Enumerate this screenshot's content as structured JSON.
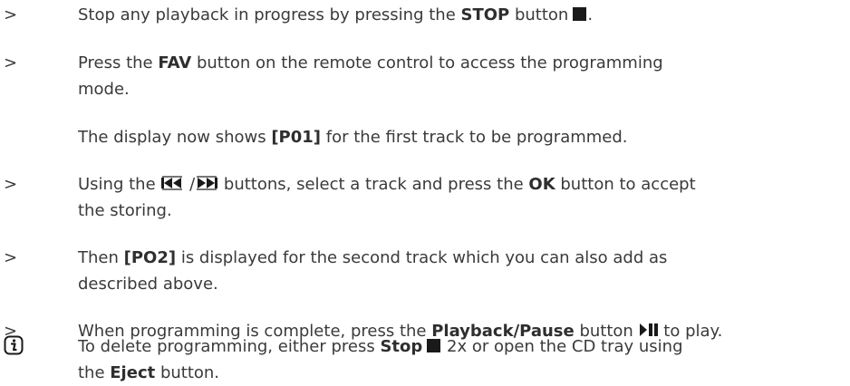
{
  "markers": {
    "bullet": ">"
  },
  "steps": [
    {
      "pre": "Stop any playback in progress by pressing the ",
      "bold": "STOP",
      "post": " button",
      "tail": "."
    },
    {
      "pre": "Press the ",
      "bold": "FAV",
      "post_line1": " button on the remote control to access the programming",
      "line2": "mode."
    },
    {
      "pre": "The display now shows ",
      "bold": "[P01]",
      "post": " for the first track to be programmed."
    },
    {
      "pre": "Using the ",
      "sep": " /",
      "mid": " buttons, select a track and press the ",
      "bold": "OK",
      "post_line1": " button to accept",
      "line2": "the storing."
    },
    {
      "pre": "Then ",
      "bold": "[PO2]",
      "post_line1": " is displayed for the second track which you can also add as",
      "line2": "described above."
    },
    {
      "pre": "When programming is complete, press the ",
      "bold": "Playback/Pause",
      "post": " button",
      "tail": " to play."
    }
  ],
  "note": {
    "pre": "To delete programming, either press ",
    "bold1": "Stop",
    "mid": " 2x or open the CD tray using",
    "line2_pre": "the ",
    "bold2": "Eject",
    "line2_post": " button."
  },
  "icons": {
    "stop": "stop-icon",
    "skip_back": "skip-back-icon",
    "skip_forward": "skip-forward-icon",
    "play_pause": "play-pause-icon",
    "info": "info-icon"
  }
}
